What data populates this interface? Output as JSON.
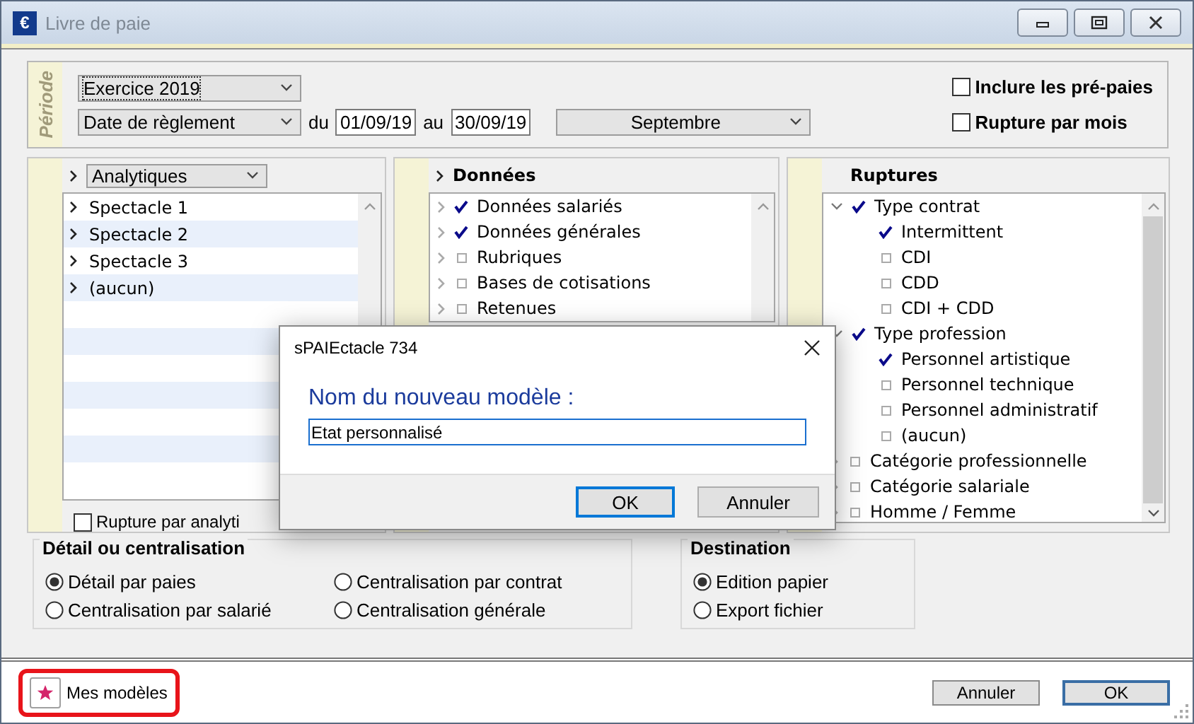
{
  "window": {
    "title": "Livre de paie",
    "icon_glyph": "€"
  },
  "period": {
    "label": "Période",
    "exercise": "Exercice 2019",
    "date_type": "Date de règlement",
    "from_label": "du",
    "from": "01/09/19",
    "to_label": "au",
    "to": "30/09/19",
    "month": "Septembre",
    "options": [
      {
        "label": "Inclure les pré-paies",
        "checked": false
      },
      {
        "label": "Rupture par mois",
        "checked": false
      }
    ]
  },
  "analytics": {
    "select": "Analytiques",
    "items": [
      "Spectacle 1",
      "Spectacle 2",
      "Spectacle 3",
      "(aucun)"
    ],
    "checkbox": {
      "label": "Rupture par analyti",
      "checked": false
    }
  },
  "data_panel": {
    "title": "Données",
    "items": [
      {
        "label": "Données salariés",
        "checked": true
      },
      {
        "label": "Données générales",
        "checked": true
      },
      {
        "label": "Rubriques",
        "checked": false
      },
      {
        "label": "Bases de cotisations",
        "checked": false
      },
      {
        "label": "Retenues",
        "checked": false
      }
    ]
  },
  "breaks_panel": {
    "title": "Ruptures",
    "items": [
      {
        "label": "Type contrat",
        "checked": true,
        "expanded": true,
        "children": [
          {
            "label": "Intermittent",
            "checked": true
          },
          {
            "label": "CDI",
            "checked": false
          },
          {
            "label": "CDD",
            "checked": false
          },
          {
            "label": "CDI + CDD",
            "checked": false
          }
        ]
      },
      {
        "label": "Type profession",
        "checked": true,
        "expanded": true,
        "children": [
          {
            "label": "Personnel artistique",
            "checked": true
          },
          {
            "label": "Personnel technique",
            "checked": false
          },
          {
            "label": "Personnel administratif",
            "checked": false
          },
          {
            "label": "(aucun)",
            "checked": false
          }
        ]
      },
      {
        "label": "Catégorie professionnelle",
        "checked": false,
        "expanded": false
      },
      {
        "label": "Catégorie salariale",
        "checked": false,
        "expanded": false
      },
      {
        "label": "Homme / Femme",
        "checked": false,
        "expanded": false
      }
    ]
  },
  "detail_group": {
    "title": "Détail ou centralisation",
    "options": [
      {
        "label": "Détail par paies",
        "selected": true
      },
      {
        "label": "Centralisation par contrat",
        "selected": false
      },
      {
        "label": "Centralisation par salarié",
        "selected": false
      },
      {
        "label": "Centralisation générale",
        "selected": false
      }
    ]
  },
  "destination_group": {
    "title": "Destination",
    "options": [
      {
        "label": "Edition papier",
        "selected": true
      },
      {
        "label": "Export fichier",
        "selected": false
      }
    ]
  },
  "footer": {
    "templates_button": "Mes modèles",
    "buttons": [
      "Annuler",
      "OK"
    ]
  },
  "dialog": {
    "title": "sPAIEctacle 734",
    "prompt": "Nom du nouveau modèle :",
    "value": "Etat personnalisé",
    "buttons": [
      "OK",
      "Annuler"
    ]
  }
}
